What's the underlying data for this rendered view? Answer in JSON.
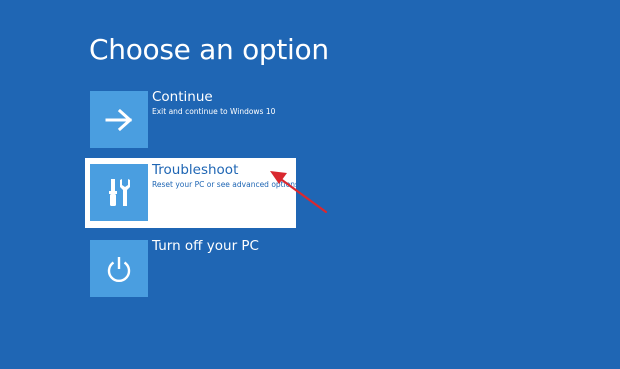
{
  "page": {
    "title": "Choose an option"
  },
  "options": [
    {
      "label": "Continue",
      "description": "Exit and continue to Windows 10",
      "icon": "arrow-right-icon"
    },
    {
      "label": "Troubleshoot",
      "description": "Reset your PC or see advanced options",
      "icon": "tools-icon",
      "selected": true
    },
    {
      "label": "Turn off your PC",
      "description": "",
      "icon": "power-icon"
    }
  ],
  "colors": {
    "background": "#1f66b4",
    "tile": "#4a9ee0",
    "selection": "#ffffff",
    "annotation_arrow": "#d9282f"
  }
}
